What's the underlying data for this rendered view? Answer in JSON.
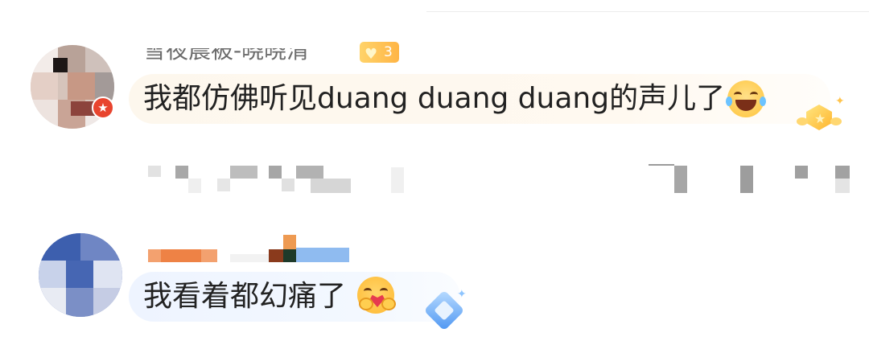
{
  "comments": [
    {
      "username": "雪夜晨被-晓晓清",
      "badge": "3",
      "text": "我都仿佛听见duang duang duang的声儿了"
    },
    {
      "username": "",
      "text": "我看着都幻痛了"
    }
  ],
  "icons": {
    "badge_heart": "♥",
    "verified": "★",
    "sparkle": "✦"
  },
  "colors": {
    "bubble1": "#fdf6ea",
    "bubble2": "#eef5ff",
    "verified": "#e8442e",
    "gold_badge": "#ffc44d",
    "blue_badge": "#5aa5ff"
  }
}
